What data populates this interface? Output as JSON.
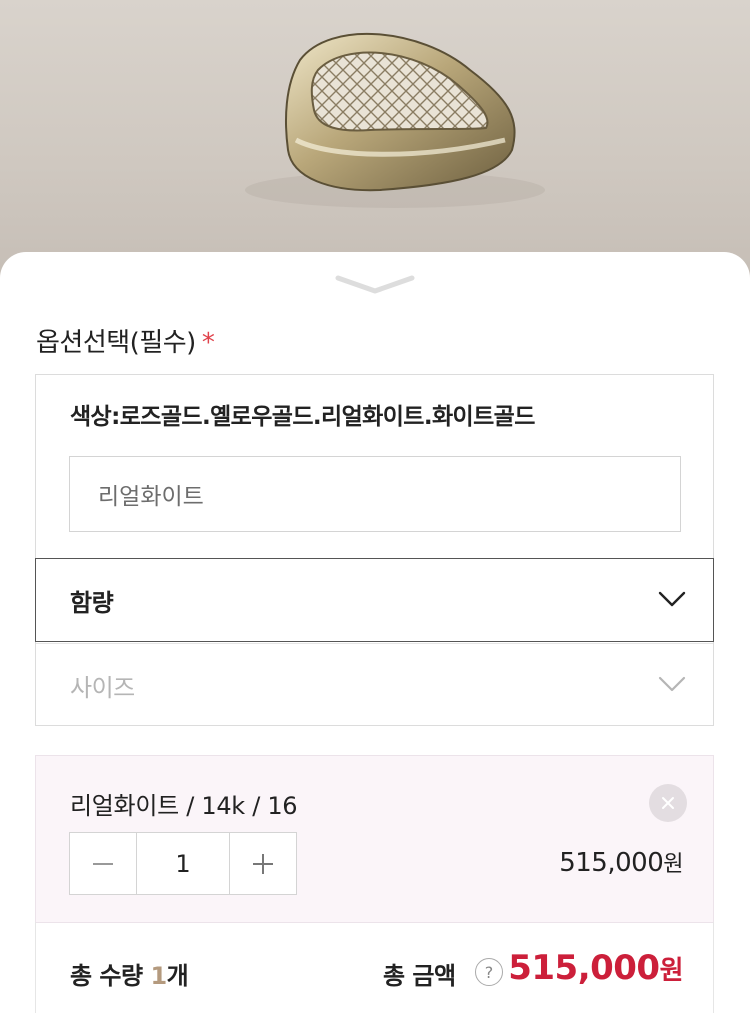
{
  "product_image": {
    "alt": "gold ring photo"
  },
  "sheet": {
    "handle_icon": "chevron-down-icon",
    "option_title": "옵션선택(필수)",
    "required_mark": "*"
  },
  "options": {
    "color_label": "색상:로즈골드.옐로우골드.리얼화이트.화이트골드",
    "color_value": "리얼화이트",
    "weight_select": "함량",
    "size_select": "사이즈"
  },
  "selected_item": {
    "name": "리얼화이트 / 14k / 16",
    "quantity": "1",
    "price": "515,000",
    "price_unit": "원",
    "minus_icon": "minus-icon",
    "plus_icon": "plus-icon",
    "remove_icon": "close-icon"
  },
  "totals": {
    "qty_prefix": "총 수량 ",
    "qty_value": "1",
    "qty_unit": "개",
    "amount_label": "총 금액",
    "help_icon": "?",
    "amount_value": "515,000",
    "amount_unit": "원"
  },
  "colors": {
    "accent_red": "#cc1f3a",
    "required_red": "#e0424b",
    "qty_highlight": "#b49a7e",
    "card_background": "#fbf5f9"
  }
}
